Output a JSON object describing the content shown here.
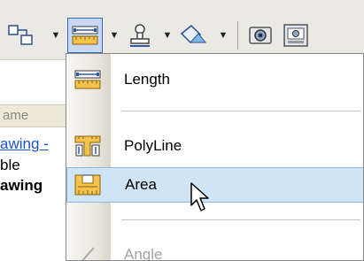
{
  "menu": {
    "items": [
      {
        "label": "Length",
        "icon": "length-ruler-icon"
      },
      {
        "label": "PolyLine",
        "icon": "polyline-ruler-icon"
      },
      {
        "label": "Area",
        "icon": "area-ruler-icon",
        "highlighted": true
      },
      {
        "label": "Angle",
        "icon": "angle-icon",
        "disabled": true
      }
    ]
  },
  "background_list": {
    "header": "ame",
    "rows": [
      "awing -",
      "ble",
      "awing"
    ]
  },
  "toolbar": {
    "icons": [
      "shape-icon",
      "measure-ruler-icon",
      "stamp-icon",
      "fill-icon",
      "camera-icon",
      "snapshot-icon"
    ]
  },
  "colors": {
    "menu_highlight": "#cfe4f4",
    "menu_highlight_border": "#8fb7dc",
    "link": "#1c52c0"
  }
}
